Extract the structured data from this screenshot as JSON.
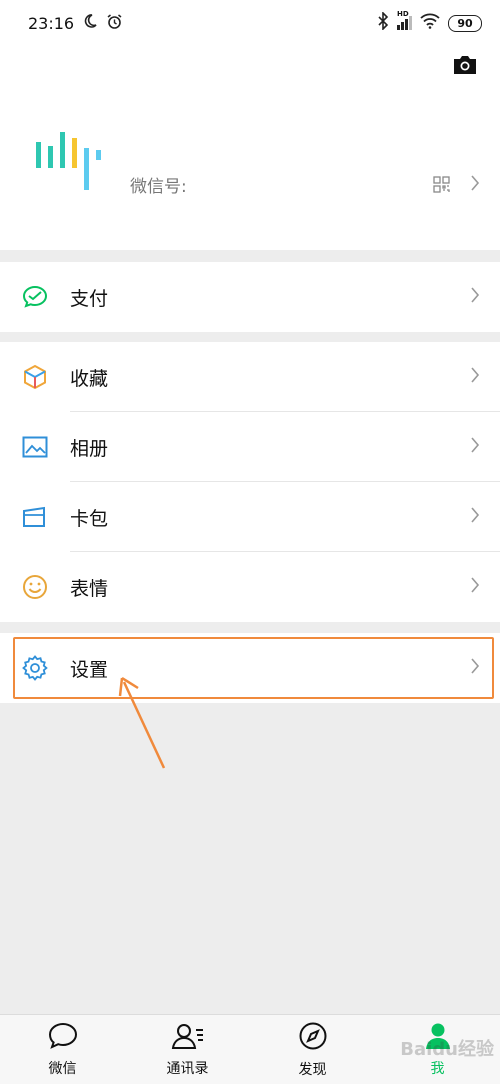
{
  "status_bar": {
    "time": "23:16",
    "battery": "90",
    "network": "HD"
  },
  "profile": {
    "wechat_id_label": "微信号:"
  },
  "menu": {
    "pay": "支付",
    "favorites": "收藏",
    "album": "相册",
    "cards": "卡包",
    "stickers": "表情",
    "settings": "设置"
  },
  "tabbar": {
    "chats": "微信",
    "contacts": "通讯录",
    "discover": "发现",
    "me": "我",
    "watermark": "Baidu经验"
  },
  "colors": {
    "brand_green": "#07c160",
    "highlight_orange": "#f08a3c",
    "page_bg": "#ededed"
  }
}
